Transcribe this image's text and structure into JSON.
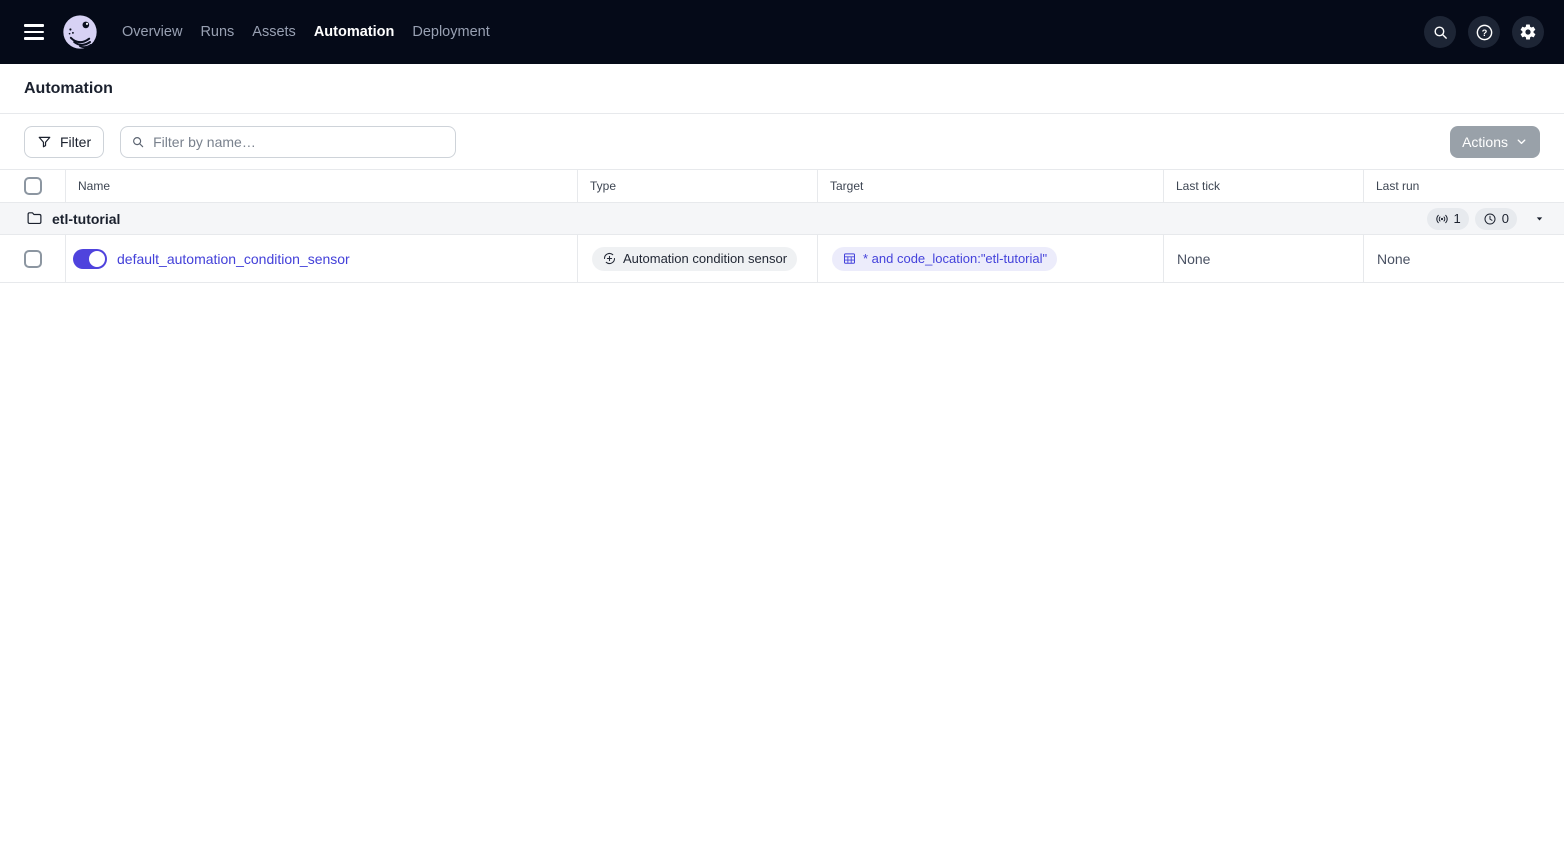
{
  "header": {
    "nav": [
      {
        "label": "Overview",
        "active": false
      },
      {
        "label": "Runs",
        "active": false
      },
      {
        "label": "Assets",
        "active": false
      },
      {
        "label": "Automation",
        "active": true
      },
      {
        "label": "Deployment",
        "active": false
      }
    ],
    "icons": [
      "menu-icon",
      "dagster-logo",
      "search-icon",
      "help-icon",
      "gear-icon"
    ]
  },
  "page": {
    "title": "Automation"
  },
  "toolbar": {
    "filter_label": "Filter",
    "search_placeholder": "Filter by name…",
    "search_value": "",
    "actions_label": "Actions"
  },
  "table": {
    "columns": [
      "Name",
      "Type",
      "Target",
      "Last tick",
      "Last run"
    ],
    "group": {
      "name": "etl-tutorial",
      "sensor_count": "1",
      "schedule_count": "0"
    },
    "rows": [
      {
        "name": "default_automation_condition_sensor",
        "enabled": true,
        "type": "Automation condition sensor",
        "target": "* and code_location:\"etl-tutorial\"",
        "last_tick": "None",
        "last_run": "None"
      }
    ]
  },
  "colors": {
    "header_bg": "#050a18",
    "accent_blurple": "#4f43dd",
    "link": "#4340d9",
    "target_badge_bg": "#ececfb",
    "badge_bg": "#eff1f3",
    "group_row_bg": "#f5f6f8",
    "border": "#e7e9ec",
    "actions_disabled_bg": "#99a1a9",
    "logo_lavender": "#d7d2f4"
  }
}
